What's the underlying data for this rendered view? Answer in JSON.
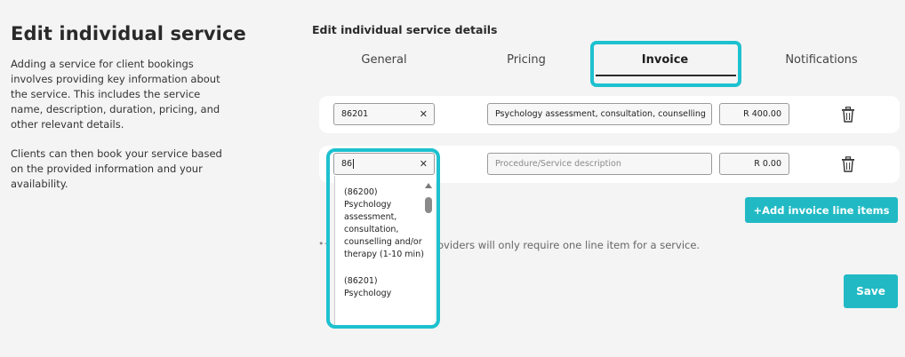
{
  "left": {
    "title": "Edit individual service",
    "paragraph1": "Adding a service for client bookings involves providing key information about the service. This includes the service name, description, duration, pricing, and other relevant details.",
    "paragraph2": "Clients can then book your service based on the provided information and your availability."
  },
  "section_title": "Edit individual service details",
  "tabs": [
    {
      "label": "General"
    },
    {
      "label": "Pricing"
    },
    {
      "label": "Invoice",
      "active": true
    },
    {
      "label": "Notifications"
    }
  ],
  "line_items": [
    {
      "code": "86201",
      "description": "Psychology assessment, consultation, counselling",
      "price": "R 400.00"
    },
    {
      "code": "86",
      "description_placeholder": "Procedure/Service description",
      "price": "R 0.00"
    }
  ],
  "dropdown": {
    "options": [
      "(86200) Psychology assessment, consultation, counselling and/or therapy (1-10 min)",
      "(86201) Psychology"
    ]
  },
  "buttons": {
    "add_line_items": "+Add invoice line items",
    "save": "Save"
  },
  "note": "oviders will only require one line item for a service.",
  "icons": [
    "trash-icon",
    "clear-icon",
    "info-icon",
    "scroll-up-icon"
  ],
  "colors": {
    "accent": "#21bac4",
    "highlight": "#1dc1cf",
    "background": "#f4f4f4"
  }
}
